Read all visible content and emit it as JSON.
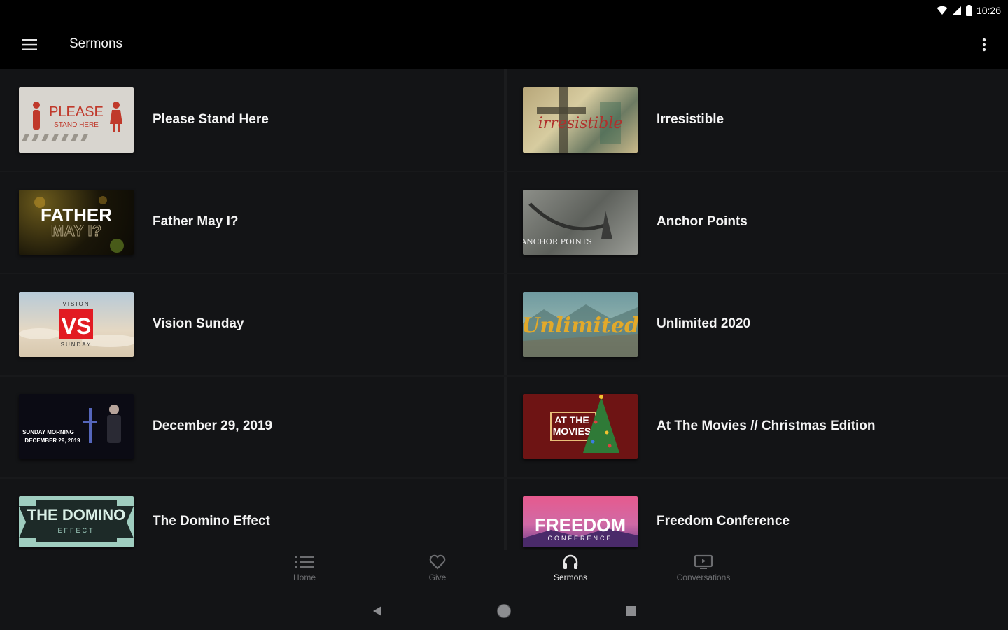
{
  "status": {
    "time": "10:26"
  },
  "appbar": {
    "title": "Sermons",
    "menu_icon": "hamburger-menu-icon",
    "more_icon": "more-vert-icon"
  },
  "sermons": [
    {
      "title": "Please Stand Here",
      "thumb_text": "PLEASE",
      "thumb_subtext": "STAND HERE"
    },
    {
      "title": "Irresistible",
      "thumb_text": "irresistible"
    },
    {
      "title": "Father May I?",
      "thumb_text": "FATHER",
      "thumb_subtext": "MAY I?"
    },
    {
      "title": "Anchor Points",
      "thumb_text": "ANCHOR POINTS"
    },
    {
      "title": "Vision Sunday",
      "thumb_text": "VS",
      "thumb_top": "VISION",
      "thumb_bottom": "SUNDAY"
    },
    {
      "title": "Unlimited 2020",
      "thumb_text": "Unlimited"
    },
    {
      "title": "December 29, 2019",
      "thumb_text": "SUNDAY MORNING",
      "thumb_subtext": "DECEMBER 29, 2019"
    },
    {
      "title": "At The Movies // Christmas Edition",
      "thumb_text": "AT THE",
      "thumb_subtext": "MOVIES"
    },
    {
      "title": "The Domino Effect",
      "thumb_text": "THE DOMINO",
      "thumb_subtext": "EFFECT"
    },
    {
      "title": "Freedom Conference",
      "thumb_text": "FREEDOM",
      "thumb_subtext": "CONFERENCE"
    }
  ],
  "bottom_nav": [
    {
      "label": "Home",
      "icon": "list-icon",
      "active": false
    },
    {
      "label": "Give",
      "icon": "heart-icon",
      "active": false
    },
    {
      "label": "Sermons",
      "icon": "headphones-icon",
      "active": true
    },
    {
      "label": "Conversations",
      "icon": "tv-play-icon",
      "active": false
    }
  ],
  "colors": {
    "background": "#131416",
    "appbar": "#000000",
    "active_nav": "#e8e8e8",
    "inactive_nav": "#6c6d70"
  }
}
